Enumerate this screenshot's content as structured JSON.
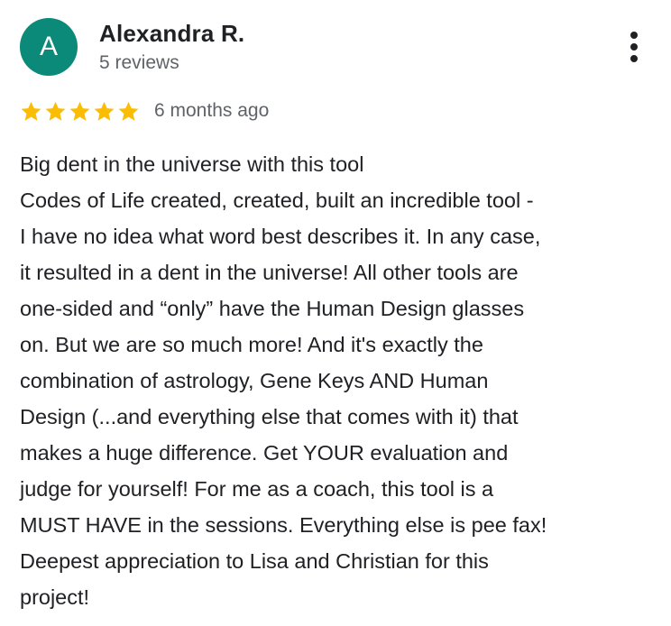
{
  "review": {
    "author": {
      "initial": "A",
      "name": "Alexandra R.",
      "reviews_count": "5 reviews",
      "avatar_color": "#0b8a7a"
    },
    "menu_icon": "more-vertical-icon",
    "rating": {
      "value": 5,
      "max": 5,
      "star_color": "#fbbc04",
      "icon": "star-icon"
    },
    "time_ago": "6 months ago",
    "text_lines": [
      "Big dent in the universe with this tool",
      "Codes of Life created, created, built an incredible tool -",
      "I have no idea what word best describes it. In any case,",
      "it resulted in a dent in the universe! All other tools are",
      "one-sided and “only” have the Human Design glasses",
      "on. But we are so much more! And it's exactly the",
      "combination of astrology, Gene Keys AND Human",
      "Design (...and everything else that comes with it) that",
      "makes a huge difference. Get YOUR evaluation and",
      "judge for yourself! For me as a coach, this tool is a",
      "MUST HAVE in the sessions. Everything else is pee fax!",
      "Deepest appreciation to Lisa and Christian for this",
      "project!"
    ]
  }
}
